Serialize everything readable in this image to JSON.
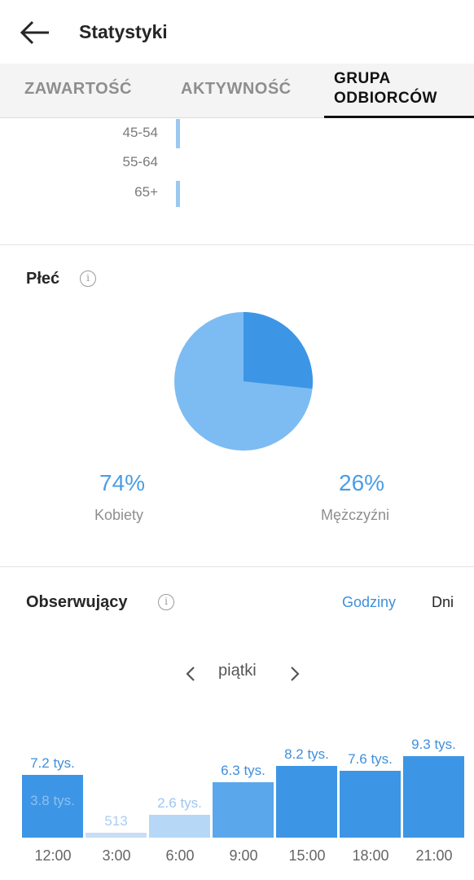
{
  "header": {
    "title": "Statystyki",
    "back_icon": "arrow-left-icon"
  },
  "tabs": [
    {
      "label": "ZAWARTOŚĆ",
      "active": false
    },
    {
      "label": "AKTYWNOŚĆ",
      "active": false
    },
    {
      "label_line1": "GRUPA",
      "label_line2": "ODBIORCÓW",
      "active": true
    }
  ],
  "age_ranges": [
    {
      "label": "45-54"
    },
    {
      "label": "55-64"
    },
    {
      "label": "65+"
    }
  ],
  "gender": {
    "title": "Płeć",
    "info_icon": "info-icon",
    "women": {
      "percent": "74%",
      "label": "Kobiety",
      "value": 74,
      "color": "#7dbcf2"
    },
    "men": {
      "percent": "26%",
      "label": "Mężczyźni",
      "value": 26,
      "color": "#3d95e5"
    }
  },
  "followers": {
    "title": "Obserwujący",
    "info_icon": "info-icon",
    "toggle_hours": "Godziny",
    "toggle_days": "Dni",
    "day": "piątki",
    "prev_icon": "chevron-left-icon",
    "next_icon": "chevron-right-icon"
  },
  "chart_data": {
    "type": "bar",
    "categories": [
      "12:00",
      "3:00",
      "6:00",
      "9:00",
      "15:00",
      "18:00",
      "21:00"
    ],
    "values": [
      7200,
      513,
      2600,
      6300,
      8200,
      7600,
      9300
    ],
    "labels": [
      "7.2 tys.",
      "513",
      "2.6 tys.",
      "6.3 tys.",
      "8.2 tys.",
      "7.6 tys.",
      "9.3 tys."
    ],
    "secondary_value": 3800,
    "secondary_label": "3.8 tys.",
    "ylim": [
      0,
      9300
    ]
  }
}
